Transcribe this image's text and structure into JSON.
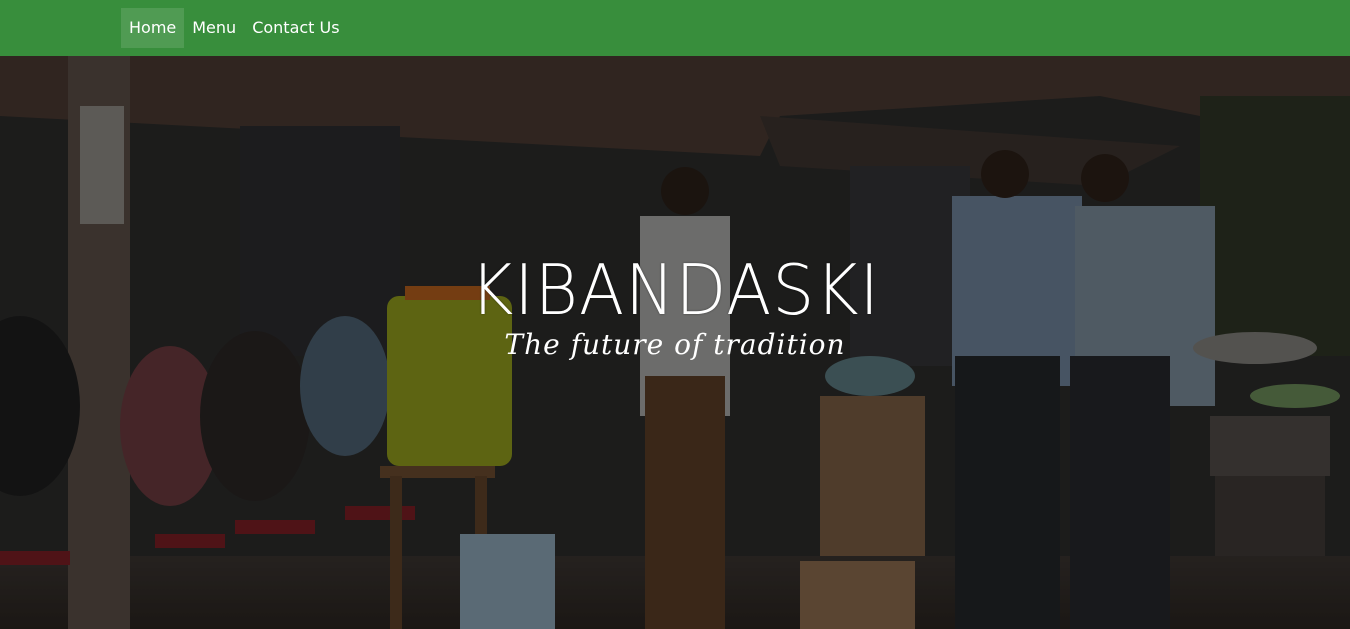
{
  "nav": {
    "items": [
      {
        "label": "Home",
        "active": true
      },
      {
        "label": "Menu",
        "active": false
      },
      {
        "label": "Contact Us",
        "active": false
      }
    ],
    "background_color": "#388e3c"
  },
  "hero": {
    "title": "KIBANDASKI",
    "subtitle": "The future of tradition",
    "background_image": "street-food-stall-photo"
  }
}
